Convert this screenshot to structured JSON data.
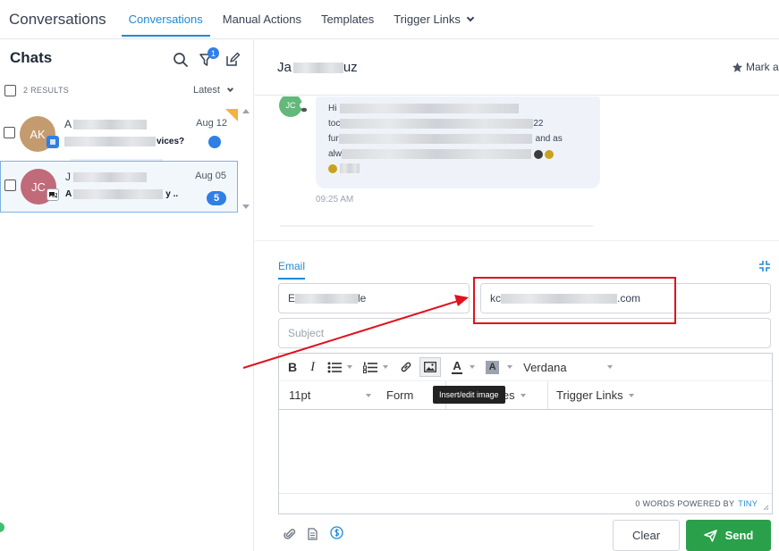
{
  "app": {
    "title": "Conversations"
  },
  "nav": {
    "tabs": [
      {
        "label": "Conversations"
      },
      {
        "label": "Manual Actions"
      },
      {
        "label": "Templates"
      },
      {
        "label": "Trigger Links"
      }
    ],
    "active_tab": "Conversations"
  },
  "sidebar": {
    "title": "Chats",
    "filter_badge": "1",
    "results_label": "2 RESULTS",
    "sort_label": "Latest",
    "chats": [
      {
        "initials": "AK",
        "name_start": "A",
        "preview_end": "vices?",
        "date": "Aug 12",
        "avatar_color": "#c49b6f",
        "unread": ""
      },
      {
        "initials": "JC",
        "name_start": "J",
        "preview_start": "A",
        "preview_end": "y ..",
        "date": "Aug 05",
        "avatar_color": "#c06a7a",
        "unread": "5"
      }
    ]
  },
  "conversation": {
    "contact_name_start": "Ja",
    "contact_name_end": "uz",
    "mark_label": "Mark a",
    "avatar_initials": "JC",
    "message": {
      "line1_start": "Hi",
      "line2_start": "toc",
      "line2_end": "22",
      "line3_start": "fur",
      "line3_end": "and as",
      "line4_start": "alw",
      "time": "09:25 AM"
    }
  },
  "composer": {
    "channel_tab": "Email",
    "from_start": "E",
    "from_end": "le",
    "to_start": "kc",
    "to_end": ".com",
    "subject_placeholder": "Subject",
    "toolbar": {
      "bold": "B",
      "italic": "I",
      "font_family": "Verdana",
      "font_size": "11pt",
      "formats_partial": "Form",
      "custom_values_partial": "n Values",
      "trigger_links": "Trigger Links",
      "tooltip": "Insert/edit image",
      "text_color": "A",
      "bg_color": "A"
    },
    "footer_words": "0 WORDS POWERED BY",
    "footer_tiny": "TINY",
    "clear_label": "Clear",
    "send_label": "Send"
  },
  "colors": {
    "accent": "#1d8ad6",
    "send": "#2aa04a",
    "highlight": "#e0121e",
    "badge": "#2f7fe6"
  }
}
